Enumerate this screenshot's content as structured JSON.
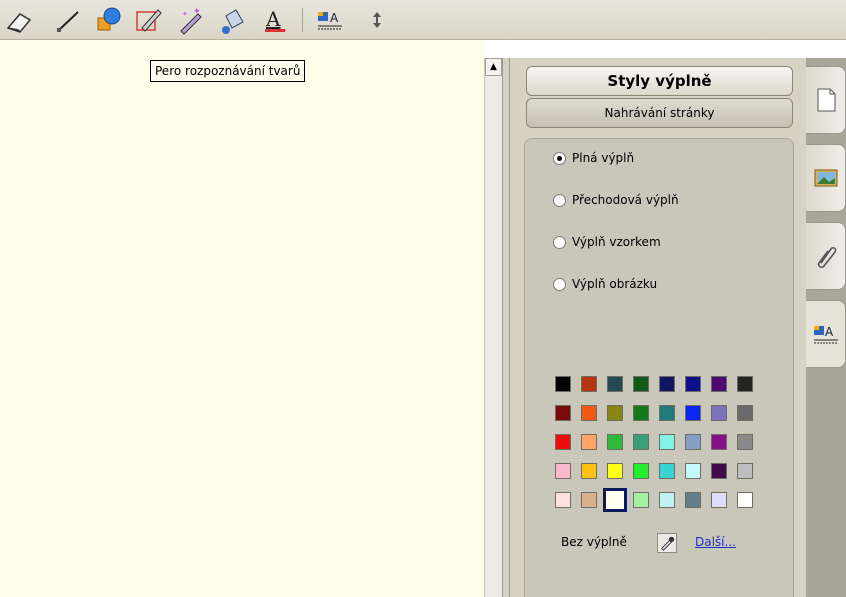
{
  "toolbar": {
    "tools": [
      {
        "name": "eraser-icon"
      },
      {
        "name": "line-icon"
      },
      {
        "name": "shapes-icon"
      },
      {
        "name": "shape-recognition-pen-icon"
      },
      {
        "name": "magic-pen-icon"
      },
      {
        "name": "fill-bucket-icon"
      },
      {
        "name": "text-color-icon"
      },
      {
        "name": "fill-styles-icon"
      },
      {
        "name": "more-arrows-icon"
      }
    ]
  },
  "canvas": {
    "tooltip": "Pero rozpoznávání tvarů",
    "background": "#fefee8"
  },
  "panel": {
    "title": "Styly výplně",
    "upload_label": "Nahrávání stránky",
    "radio_options": [
      {
        "label": "Plná výplň",
        "checked": true
      },
      {
        "label": "Přechodová výplň",
        "checked": false
      },
      {
        "label": "Výplň vzorkem",
        "checked": false
      },
      {
        "label": "Výplň obrázku",
        "checked": false
      }
    ],
    "palette": [
      [
        "#000000",
        "#b5360f",
        "#1f4b52",
        "#0f5a16",
        "#0f1462",
        "#0c0f8f",
        "#4c0b74",
        "#242424"
      ],
      [
        "#7a0909",
        "#f05a13",
        "#888510",
        "#137a17",
        "#1e7a7c",
        "#0a26f0",
        "#7b73bd",
        "#6a6a6a"
      ],
      [
        "#ee0c0c",
        "#ffa565",
        "#2fbb3a",
        "#38a076",
        "#80f2e6",
        "#859ec7",
        "#870f8a",
        "#8a8a8a"
      ],
      [
        "#f9b9c8",
        "#ffc012",
        "#ffff13",
        "#1ff12a",
        "#37d6d6",
        "#c3f8fd",
        "#410b4b",
        "#bdbdbd"
      ],
      [
        "#ffe1e1",
        "#d9b289",
        "#ffffed",
        "#a2f0a2",
        "#bff2f2",
        "#627c8c",
        "#dcdcfb",
        "#ffffff"
      ]
    ],
    "selected_swatch": [
      4,
      2
    ],
    "nofill_label": "Bez výplně",
    "more_link": "Další..."
  }
}
